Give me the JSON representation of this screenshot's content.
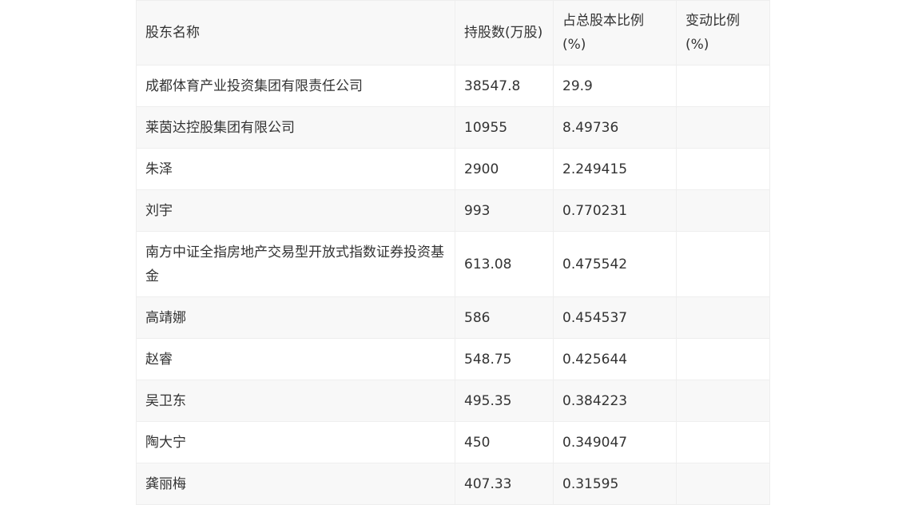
{
  "table": {
    "headers": [
      "股东名称",
      "持股数(万股)",
      "占总股本比例(%)",
      "变动比例(%)"
    ],
    "rows": [
      {
        "name": "成都体育产业投资集团有限责任公司",
        "shares": "38547.8",
        "ratio": "29.9",
        "change": ""
      },
      {
        "name": "莱茵达控股集团有限公司",
        "shares": "10955",
        "ratio": "8.49736",
        "change": ""
      },
      {
        "name": "朱泽",
        "shares": "2900",
        "ratio": "2.249415",
        "change": ""
      },
      {
        "name": "刘宇",
        "shares": "993",
        "ratio": "0.770231",
        "change": ""
      },
      {
        "name": "南方中证全指房地产交易型开放式指数证券投资基金",
        "shares": "613.08",
        "ratio": "0.475542",
        "change": ""
      },
      {
        "name": "高靖娜",
        "shares": "586",
        "ratio": "0.454537",
        "change": ""
      },
      {
        "name": "赵睿",
        "shares": "548.75",
        "ratio": "0.425644",
        "change": ""
      },
      {
        "name": "吴卫东",
        "shares": "495.35",
        "ratio": "0.384223",
        "change": ""
      },
      {
        "name": "陶大宁",
        "shares": "450",
        "ratio": "0.349047",
        "change": ""
      },
      {
        "name": "龚丽梅",
        "shares": "407.33",
        "ratio": "0.31595",
        "change": ""
      }
    ]
  }
}
